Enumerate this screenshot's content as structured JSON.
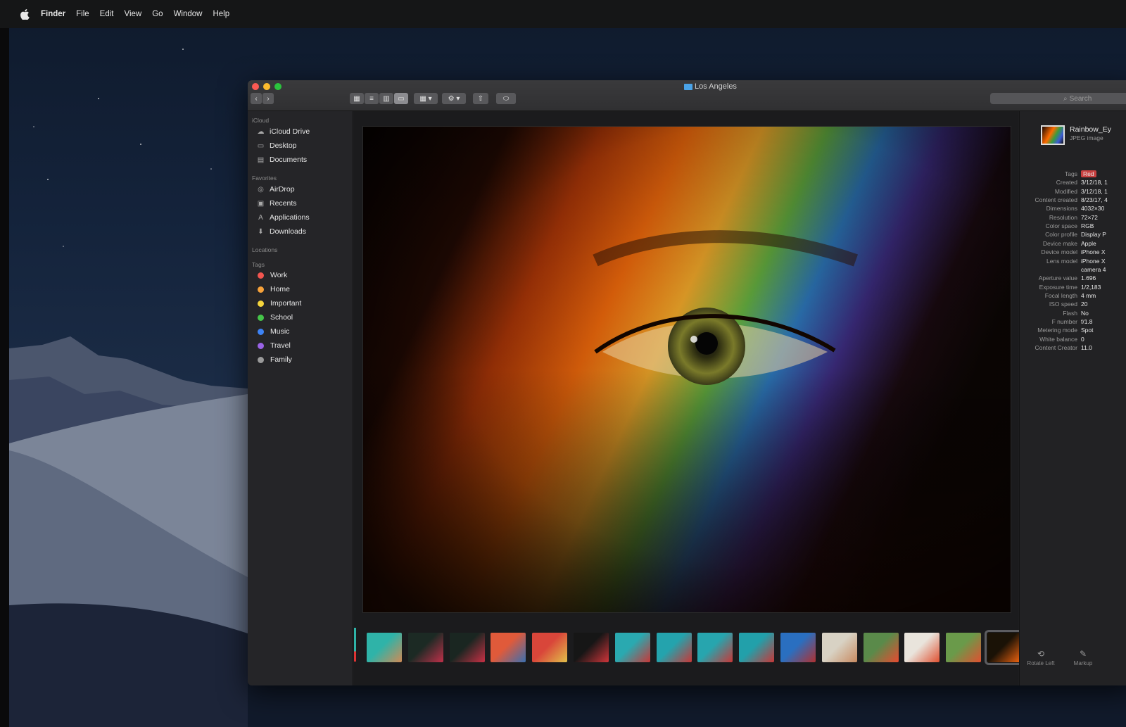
{
  "menubar": {
    "app": "Finder",
    "items": [
      "File",
      "Edit",
      "View",
      "Go",
      "Window",
      "Help"
    ]
  },
  "window": {
    "title": "Los Angeles",
    "search_placeholder": "Search",
    "toolbar": {
      "back": "‹",
      "forward": "›",
      "view_icons": "▦",
      "view_list": "≡",
      "view_columns": "▥",
      "view_gallery": "▭",
      "group": "▦ ▾",
      "action": "⚙ ▾",
      "share": "⇧",
      "tag": "⬭"
    }
  },
  "sidebar": {
    "sections": [
      {
        "title": "iCloud",
        "items": [
          {
            "label": "iCloud Drive",
            "icon": "cloud-icon",
            "glyph": "☁"
          },
          {
            "label": "Desktop",
            "icon": "desktop-icon",
            "glyph": "▭"
          },
          {
            "label": "Documents",
            "icon": "documents-icon",
            "glyph": "▤"
          }
        ]
      },
      {
        "title": "Favorites",
        "items": [
          {
            "label": "AirDrop",
            "icon": "airdrop-icon",
            "glyph": "◎"
          },
          {
            "label": "Recents",
            "icon": "recents-icon",
            "glyph": "▣"
          },
          {
            "label": "Applications",
            "icon": "applications-icon",
            "glyph": "A"
          },
          {
            "label": "Downloads",
            "icon": "downloads-icon",
            "glyph": "⬇"
          }
        ]
      },
      {
        "title": "Locations",
        "items": []
      }
    ],
    "tags_title": "Tags",
    "tags": [
      {
        "label": "Work",
        "color": "#f2554f"
      },
      {
        "label": "Home",
        "color": "#f7a23a"
      },
      {
        "label": "Important",
        "color": "#f5d53c"
      },
      {
        "label": "School",
        "color": "#45c549"
      },
      {
        "label": "Music",
        "color": "#3d83f5"
      },
      {
        "label": "Travel",
        "color": "#9a63e6"
      },
      {
        "label": "Family",
        "color": "#9a9a9a"
      }
    ]
  },
  "inspector": {
    "file_name": "Rainbow_Ey",
    "file_kind": "JPEG image",
    "tag_value": "Red",
    "rows": [
      {
        "key": "Tags",
        "value": "Red"
      },
      {
        "key": "Created",
        "value": "3/12/18, 1"
      },
      {
        "key": "Modified",
        "value": "3/12/18, 1"
      },
      {
        "key": "Content created",
        "value": "8/23/17, 4"
      },
      {
        "key": "Dimensions",
        "value": "4032×30"
      },
      {
        "key": "Resolution",
        "value": "72×72"
      },
      {
        "key": "Color space",
        "value": "RGB"
      },
      {
        "key": "Color profile",
        "value": "Display P"
      },
      {
        "key": "Device make",
        "value": "Apple"
      },
      {
        "key": "Device model",
        "value": "iPhone X"
      },
      {
        "key": "Lens model",
        "value": "iPhone X"
      },
      {
        "key": "",
        "value": "camera 4"
      },
      {
        "key": "Aperture value",
        "value": "1.696"
      },
      {
        "key": "Exposure time",
        "value": "1/2,183"
      },
      {
        "key": "Focal length",
        "value": "4 mm"
      },
      {
        "key": "ISO speed",
        "value": "20"
      },
      {
        "key": "Flash",
        "value": "No"
      },
      {
        "key": "F number",
        "value": "f/1.8"
      },
      {
        "key": "Metering mode",
        "value": "Spot"
      },
      {
        "key": "White balance",
        "value": "0"
      },
      {
        "key": "Content Creator",
        "value": "11.0"
      }
    ],
    "actions": [
      {
        "label": "Rotate Left",
        "icon": "rotate-left-icon",
        "glyph": "⟲"
      },
      {
        "label": "Markup",
        "icon": "markup-icon",
        "glyph": "✎"
      }
    ]
  },
  "gallery": {
    "thumbnail_count": 16,
    "selected_index": 15,
    "thumbnails": [
      {
        "colors": [
          "#2fb3a8",
          "#d08a55"
        ]
      },
      {
        "colors": [
          "#1c2a24",
          "#c0304a"
        ]
      },
      {
        "colors": [
          "#1a2621",
          "#c93045"
        ]
      },
      {
        "colors": [
          "#e05a3a",
          "#3a6fb0"
        ]
      },
      {
        "colors": [
          "#d9463a",
          "#e2c04a"
        ]
      },
      {
        "colors": [
          "#161616",
          "#d0353a"
        ]
      },
      {
        "colors": [
          "#2aa9b0",
          "#c83737"
        ]
      },
      {
        "colors": [
          "#24a3ad",
          "#c83737"
        ]
      },
      {
        "colors": [
          "#27a5ae",
          "#c83737"
        ]
      },
      {
        "colors": [
          "#22a0aa",
          "#c83737"
        ]
      },
      {
        "colors": [
          "#2a6fc0",
          "#b03030"
        ]
      },
      {
        "colors": [
          "#d8d2c4",
          "#c88a60"
        ]
      },
      {
        "colors": [
          "#5a8a4a",
          "#e84a30"
        ]
      },
      {
        "colors": [
          "#e9e4dc",
          "#e05030"
        ]
      },
      {
        "colors": [
          "#6a9a4a",
          "#e05030"
        ]
      },
      {
        "colors": [
          "#1a1206",
          "#ff6a10"
        ]
      }
    ]
  }
}
